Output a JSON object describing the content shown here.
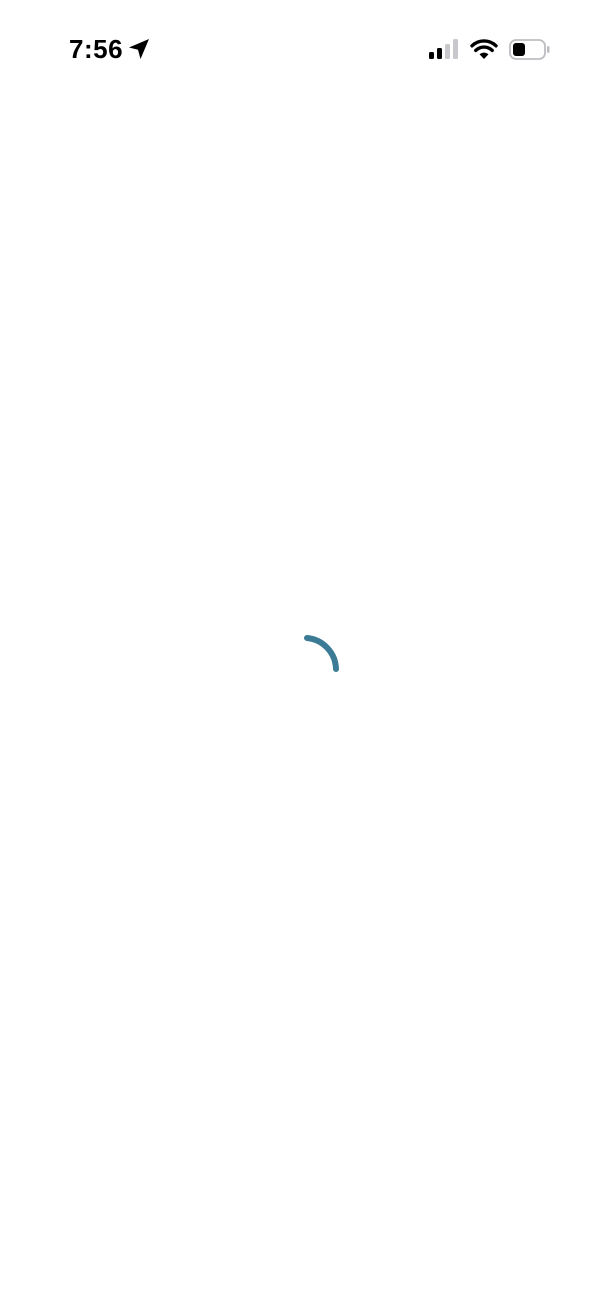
{
  "status_bar": {
    "time": "7:56",
    "icons": {
      "location": "location-arrow-icon",
      "signal": "cellular-signal-icon",
      "wifi": "wifi-icon",
      "battery": "battery-icon"
    },
    "signal_bars_active": 2,
    "signal_bars_total": 4,
    "battery_level": 0.3
  },
  "main": {
    "loading_indicator": "loading-spinner-icon",
    "accent_color": "#3b7b95"
  }
}
